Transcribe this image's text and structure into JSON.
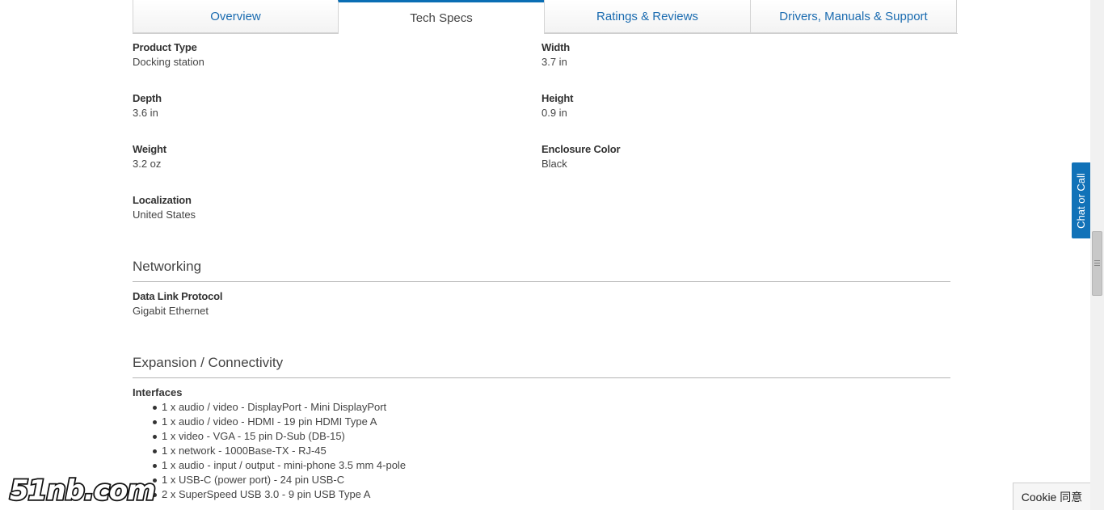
{
  "tabs": [
    {
      "label": "Overview",
      "active": false
    },
    {
      "label": "Tech Specs",
      "active": true
    },
    {
      "label": "Ratings & Reviews",
      "active": false
    },
    {
      "label": "Drivers, Manuals & Support",
      "active": false
    }
  ],
  "general": {
    "product_type": {
      "label": "Product Type",
      "value": "Docking station"
    },
    "width": {
      "label": "Width",
      "value": "3.7 in"
    },
    "depth": {
      "label": "Depth",
      "value": "3.6 in"
    },
    "height": {
      "label": "Height",
      "value": "0.9 in"
    },
    "weight": {
      "label": "Weight",
      "value": "3.2 oz"
    },
    "enclosure_color": {
      "label": "Enclosure Color",
      "value": "Black"
    },
    "localization": {
      "label": "Localization",
      "value": "United States"
    }
  },
  "networking": {
    "title": "Networking",
    "data_link_protocol": {
      "label": "Data Link Protocol",
      "value": "Gigabit Ethernet"
    }
  },
  "expansion": {
    "title": "Expansion / Connectivity",
    "interfaces_label": "Interfaces",
    "interfaces": [
      "1 x audio / video - DisplayPort - Mini DisplayPort",
      "1 x audio / video - HDMI - 19 pin HDMI Type A",
      "1 x video - VGA - 15 pin D-Sub (DB-15)",
      "1 x network - 1000Base-TX - RJ-45",
      "1 x audio - input / output - mini-phone 3.5 mm 4-pole",
      "1 x USB-C (power port) - 24 pin USB-C",
      "2 x SuperSpeed USB 3.0 - 9 pin USB Type A"
    ]
  },
  "chat_button": {
    "label": "Chat or Call"
  },
  "cookie_button": {
    "label": "Cookie 同意"
  },
  "watermark": {
    "text": "51nb.com"
  },
  "colors": {
    "link": "#1a6bb0",
    "accent": "#1172b8",
    "text": "#444444"
  }
}
